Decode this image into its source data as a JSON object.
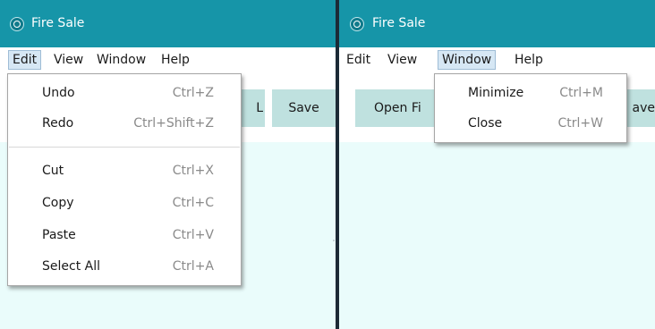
{
  "windows": {
    "left": {
      "title": "Fire Sale",
      "menu": [
        "Edit",
        "View",
        "Window",
        "Help"
      ],
      "active_menu": "Edit",
      "toolbar": {
        "button_partial": "L",
        "save": "Save"
      },
      "edit_menu": [
        {
          "label": "Undo",
          "accel": "Ctrl+Z"
        },
        {
          "label": "Redo",
          "accel": "Ctrl+Shift+Z"
        },
        {
          "label": "Cut",
          "accel": "Ctrl+X"
        },
        {
          "label": "Copy",
          "accel": "Ctrl+C"
        },
        {
          "label": "Paste",
          "accel": "Ctrl+V"
        },
        {
          "label": "Select All",
          "accel": "Ctrl+A"
        }
      ]
    },
    "right": {
      "title": "Fire Sale",
      "menu": [
        "Edit",
        "View",
        "Window",
        "Help"
      ],
      "active_menu": "Window",
      "toolbar": {
        "open_file_partial": "Open Fi",
        "save_partial": "ave"
      },
      "window_menu": [
        {
          "label": "Minimize",
          "accel": "Ctrl+M"
        },
        {
          "label": "Close",
          "accel": "Ctrl+W"
        }
      ]
    }
  },
  "colors": {
    "titlebar": "#1695a8",
    "content_bg": "#eafcfb",
    "button_bg": "#bfe1df",
    "menu_highlight": "#d6e7f4"
  },
  "icons": {
    "app": "electron-atom-icon"
  }
}
